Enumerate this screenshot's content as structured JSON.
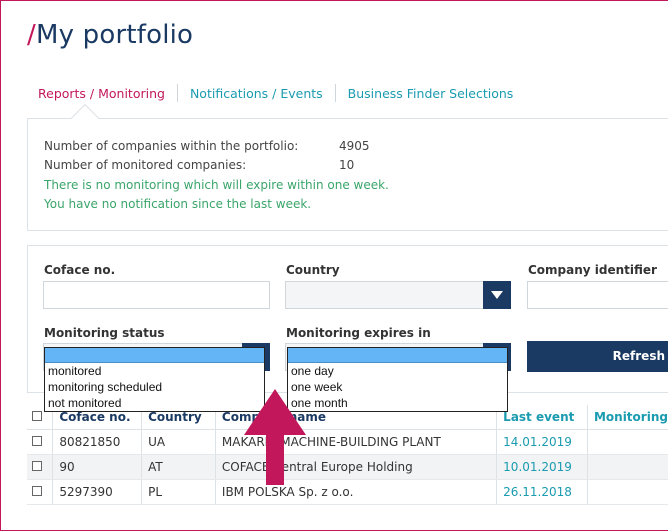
{
  "page": {
    "title": "My portfolio",
    "title_slash": "/"
  },
  "tabs": [
    {
      "label": "Reports / Monitoring",
      "active": true
    },
    {
      "label": "Notifications / Events",
      "active": false
    },
    {
      "label": "Business Finder Selections",
      "active": false
    }
  ],
  "info": {
    "companies_label": "Number of companies within the portfolio:",
    "companies_value": "4905",
    "monitored_label": "Number of monitored companies:",
    "monitored_value": "10",
    "no_expire": "There is no monitoring which will expire within one week.",
    "no_notification": "You have no notification since the last week."
  },
  "filters": {
    "coface_no_label": "Coface no.",
    "country_label": "Country",
    "company_identifier_label": "Company identifier",
    "monitoring_status_label": "Monitoring status",
    "monitoring_expires_label": "Monitoring expires in",
    "refresh_label": "Refresh",
    "status_options": [
      "monitored",
      "monitoring scheduled",
      "not monitored"
    ],
    "expires_options": [
      "one day",
      "one week",
      "one month"
    ]
  },
  "table": {
    "headers": [
      "Coface no.",
      "Country",
      "Company name",
      "Last event",
      "Monitoring"
    ],
    "rows": [
      {
        "coface_no": "80821850",
        "country": "UA",
        "company": "MAKARIV MACHINE-BUILDING PLANT",
        "last_event": "14.01.2019"
      },
      {
        "coface_no": "90",
        "country": "AT",
        "company": "COFACE Central Europe Holding",
        "last_event": "10.01.2019"
      },
      {
        "coface_no": "5297390",
        "country": "PL",
        "company": "IBM POLSKA Sp. z o.o.",
        "last_event": "26.11.2018"
      }
    ]
  },
  "colors": {
    "accent": "#c2185b",
    "navy": "#1b3a63",
    "teal": "#1a9bb0",
    "green": "#3aa56a",
    "highlight": "#64b5f6"
  },
  "icons": [
    "dropdown-arrow-icon",
    "checkbox-icon",
    "annotation-arrow-icon"
  ]
}
